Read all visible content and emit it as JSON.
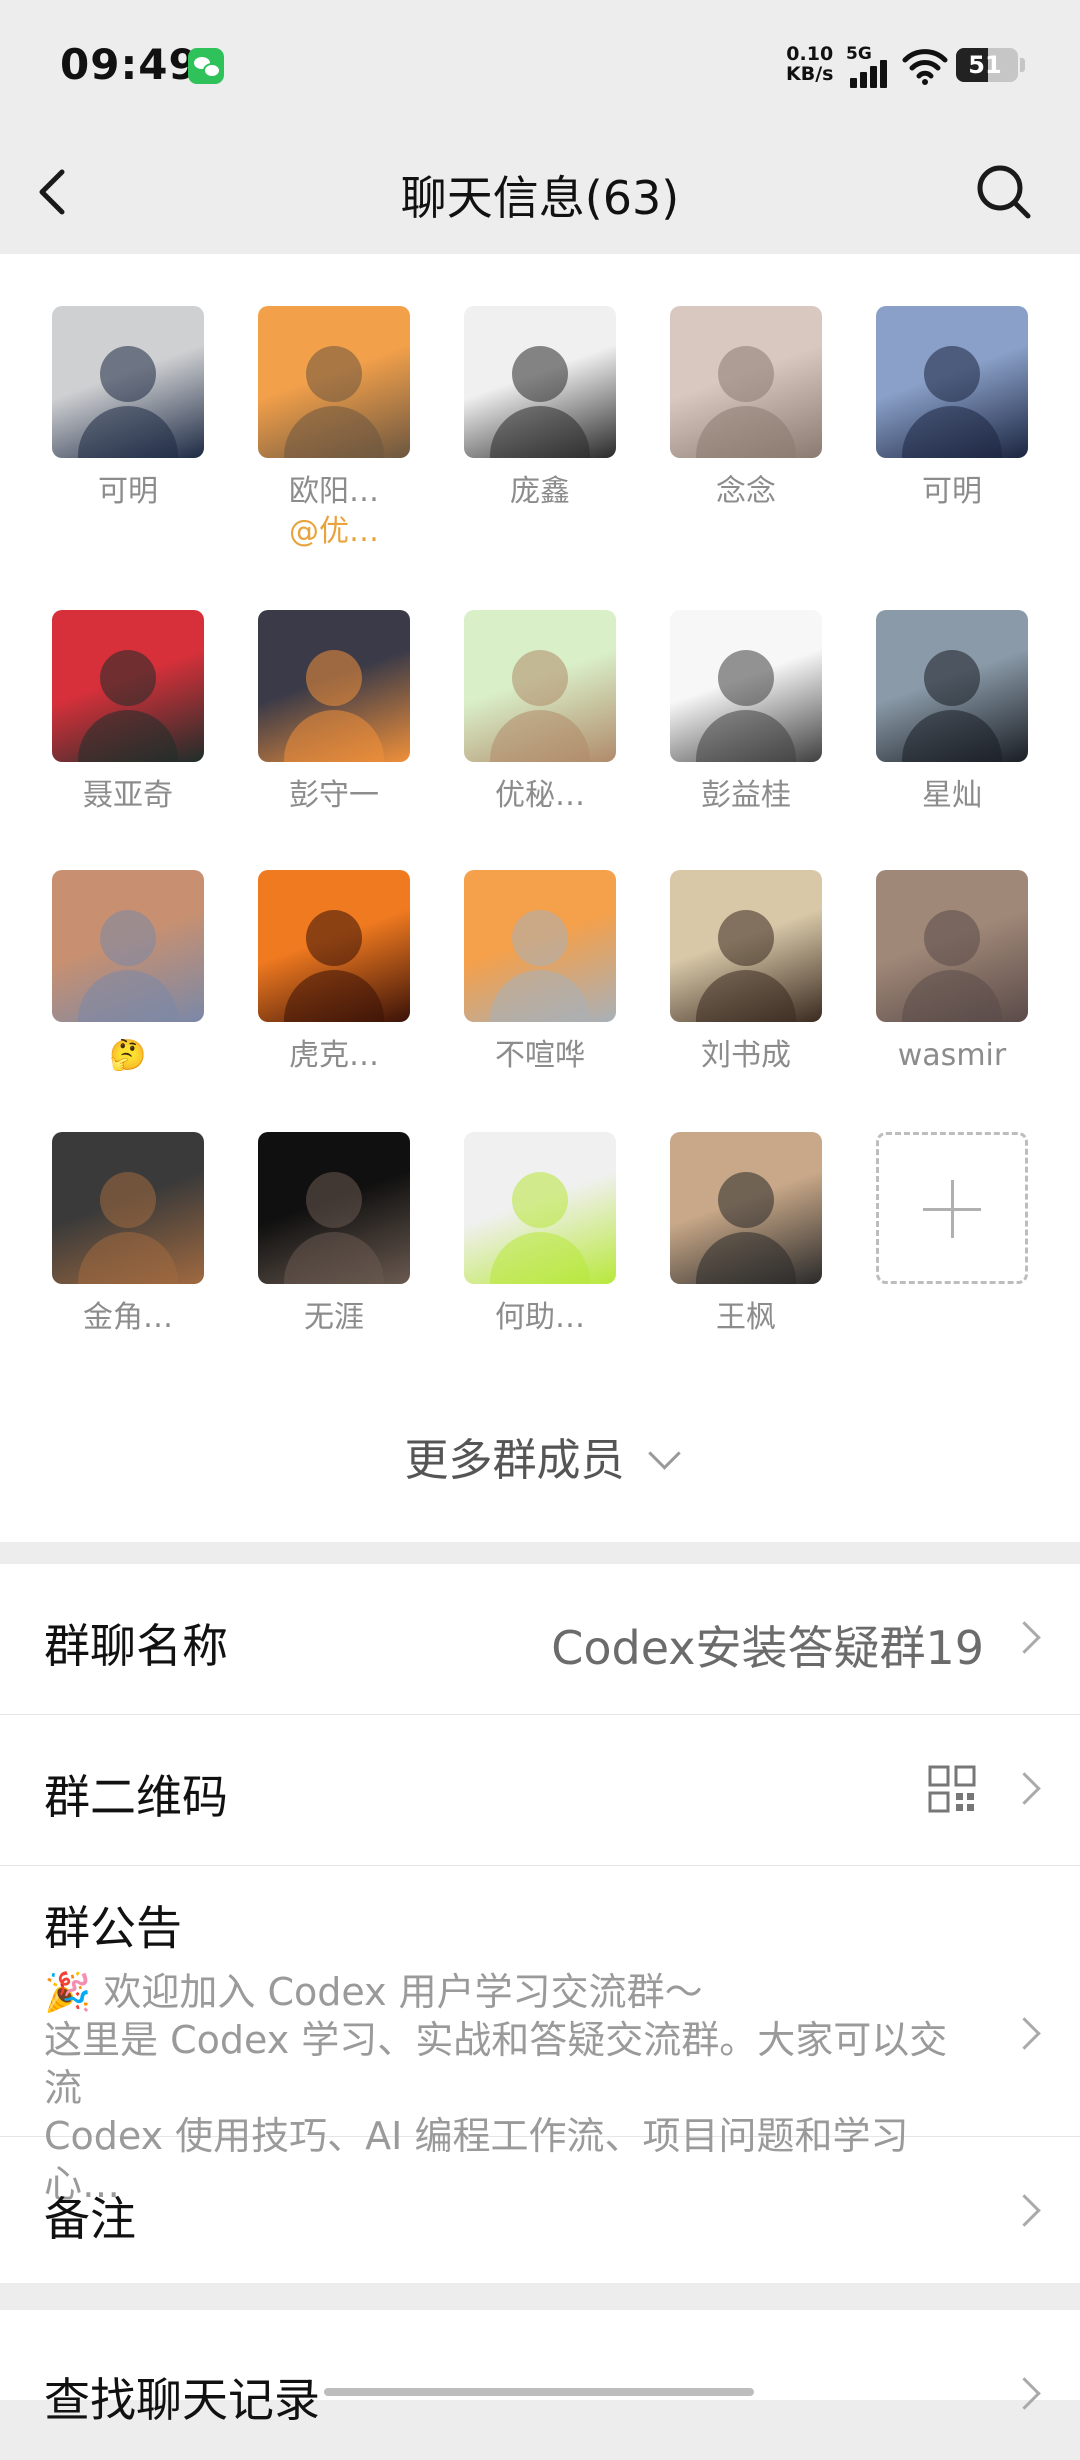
{
  "status_bar": {
    "time": "09:49",
    "net_speed_value": "0.10",
    "net_speed_unit": "KB/s",
    "network": "5G",
    "battery": "51",
    "notification_icon": "wechat-icon"
  },
  "header": {
    "title": "聊天信息(63)",
    "back_icon": "back-arrow-icon",
    "search_icon": "search-icon"
  },
  "members": [
    {
      "name": "可明",
      "avatar_colors": [
        "#cfd0d2",
        "#1d2a44"
      ]
    },
    {
      "name": "欧阳…",
      "sub": "@优…",
      "avatar_colors": [
        "#f2a04a",
        "#6b5640"
      ]
    },
    {
      "name": "庞鑫",
      "avatar_colors": [
        "#f0f0f0",
        "#2a2a2a"
      ]
    },
    {
      "name": "念念",
      "avatar_colors": [
        "#d8c8c0",
        "#8a7a70"
      ]
    },
    {
      "name": "可明",
      "avatar_colors": [
        "#8aa0c8",
        "#1b2540"
      ]
    },
    {
      "name": "聂亚奇",
      "avatar_colors": [
        "#d8303a",
        "#1e2e2a"
      ]
    },
    {
      "name": "彭守一",
      "avatar_colors": [
        "#3a3a48",
        "#f0903a"
      ]
    },
    {
      "name": "优秘…",
      "avatar_colors": [
        "#d9efc8",
        "#b08a6a"
      ]
    },
    {
      "name": "彭益桂",
      "avatar_colors": [
        "#f7f7f7",
        "#404040"
      ]
    },
    {
      "name": "星灿",
      "avatar_colors": [
        "#8a9aa8",
        "#1a1e24"
      ]
    },
    {
      "name": "🤔",
      "avatar_colors": [
        "#c89070",
        "#7a88a8"
      ]
    },
    {
      "name": "虎克…",
      "avatar_colors": [
        "#f07a20",
        "#3a1208"
      ]
    },
    {
      "name": "不喧哗",
      "avatar_colors": [
        "#f5a04a",
        "#a8b0b8"
      ]
    },
    {
      "name": "刘书成",
      "avatar_colors": [
        "#d8c8a8",
        "#3a2a20"
      ]
    },
    {
      "name": "wasmir",
      "avatar_colors": [
        "#a08878",
        "#5a4a48"
      ]
    },
    {
      "name": "金角…",
      "avatar_colors": [
        "#3a3a3a",
        "#a06a40"
      ]
    },
    {
      "name": "无涯",
      "avatar_colors": [
        "#101010",
        "#6a5a50"
      ]
    },
    {
      "name": "何助…",
      "avatar_colors": [
        "#f0f0f0",
        "#b8e83a"
      ]
    },
    {
      "name": "王枫",
      "avatar_colors": [
        "#c8a888",
        "#2a2a2a"
      ]
    }
  ],
  "add_member_icon": "plus-icon",
  "more_members": "更多群成员",
  "settings": {
    "group_name_label": "群聊名称",
    "group_name_value": "Codex安装答疑群19",
    "qr_label": "群二维码",
    "qr_icon": "qr-code-icon",
    "notice_label": "群公告",
    "notice_line1": "🎉 欢迎加入 Codex 用户学习交流群～",
    "notice_line2": "这里是 Codex 学习、实战和答疑交流群。大家可以交流",
    "notice_line3": "Codex 使用技巧、AI 编程工作流、项目问题和学习心…",
    "remark_label": "备注",
    "search_history_label": "查找聊天记录"
  }
}
